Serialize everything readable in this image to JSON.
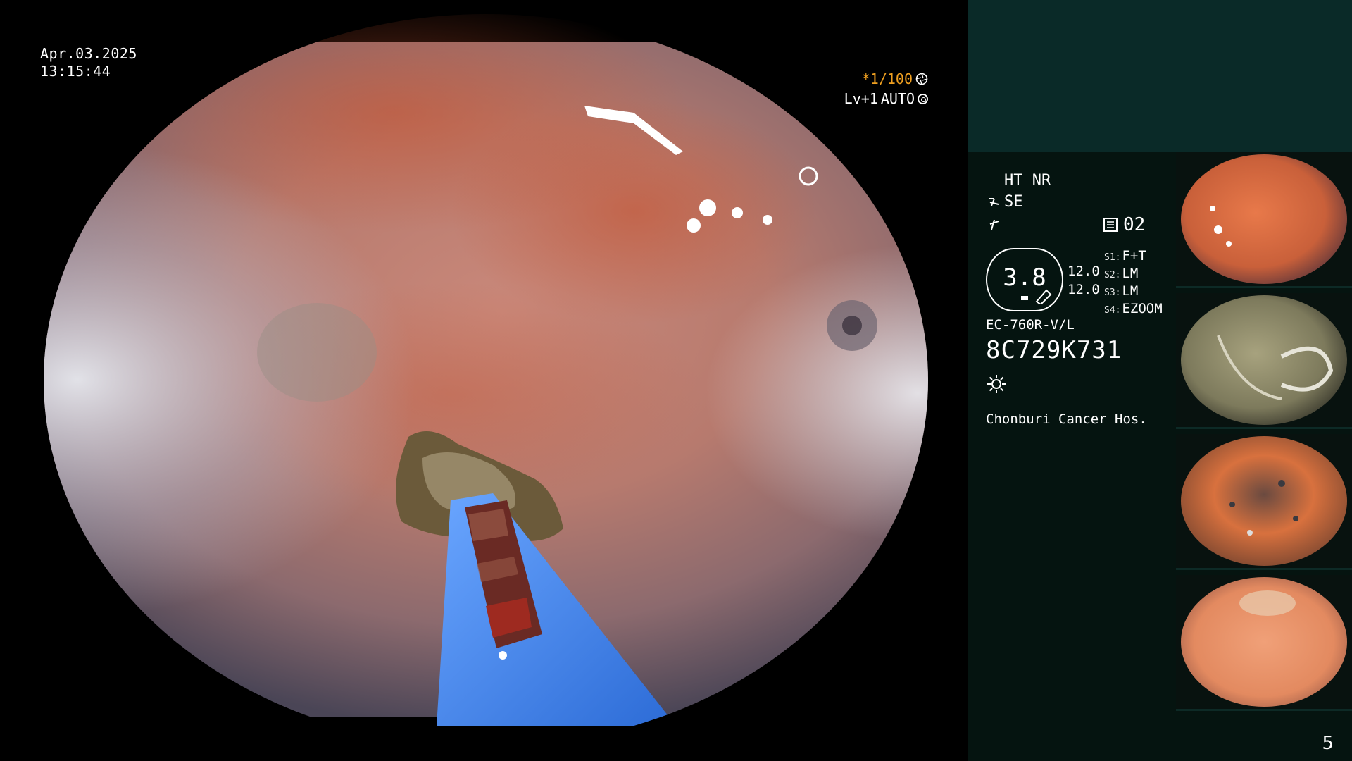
{
  "osd": {
    "date": "Apr.03.2025",
    "time": "13:15:44",
    "shutter": "*1/100",
    "shutter_icon": "aperture-icon",
    "level": "Lv+1",
    "mode": "AUTO",
    "mode_icon": "ring-icon"
  },
  "panel": {
    "ht_nr": "HT NR",
    "se": "SE",
    "mem_icon": "memory-icon",
    "mem_value": "02",
    "zoom_value": "3.8",
    "val1": "12.0",
    "val2": "12.0",
    "switches": [
      {
        "key": "S1:",
        "value": "F+T"
      },
      {
        "key": "S2:",
        "value": "LM"
      },
      {
        "key": "S3:",
        "value": "LM"
      },
      {
        "key": "S4:",
        "value": "EZOOM"
      }
    ],
    "scope_model": "EC-760R-V/L",
    "serial": "8C729K731",
    "light_icon": "light-icon",
    "hospital": "Chonburi Cancer Hos."
  },
  "page_number": "5",
  "colors": {
    "panel_bg": "#051410",
    "header_bg": "#0a2a28",
    "accent_orange": "#f0a020",
    "probe_blue": "#3f7fe0"
  },
  "thumbnails": [
    {
      "name": "thumbnail-1",
      "tone": "red-orange"
    },
    {
      "name": "thumbnail-2",
      "tone": "olive-fold"
    },
    {
      "name": "thumbnail-3",
      "tone": "orange-speckled"
    },
    {
      "name": "thumbnail-4",
      "tone": "pink-orange"
    }
  ]
}
